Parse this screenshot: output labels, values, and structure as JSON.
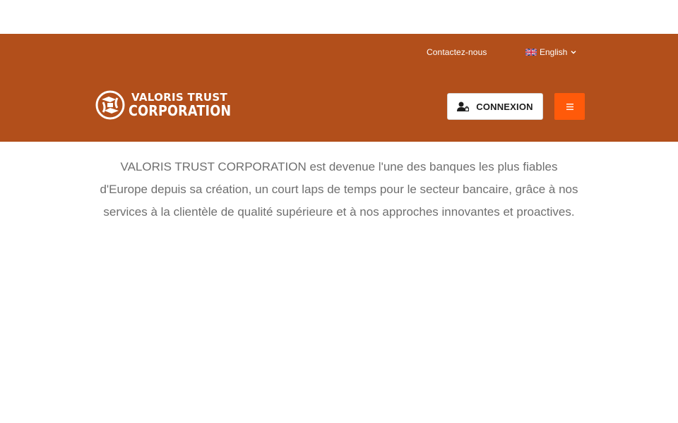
{
  "topbar": {
    "contact_label": "Contactez-nous",
    "language_label": "English",
    "language_flag_icon": "uk-flag-icon",
    "language_chevron_icon": "chevron-down-icon"
  },
  "brand": {
    "logo_line1": "VALORIS TRUST",
    "logo_line2": "CORPORATION",
    "logo_icon": "brand-emblem-icon"
  },
  "nav": {
    "login_label": "CONNEXION",
    "login_icon": "user-lock-icon",
    "menu_icon": "hamburger-menu-icon"
  },
  "main": {
    "intro_text": "VALORIS TRUST CORPORATION est devenue l'une des banques les plus fiables d'Europe depuis sa création, un court laps de temps pour le secteur bancaire, grâce à nos services à la clientèle de qualité supérieure et à nos approches innovantes et proactives."
  },
  "colors": {
    "header_bg": "#b24f1b",
    "menu_button_bg": "#ff5a0a",
    "body_text": "#6f6f6f"
  }
}
